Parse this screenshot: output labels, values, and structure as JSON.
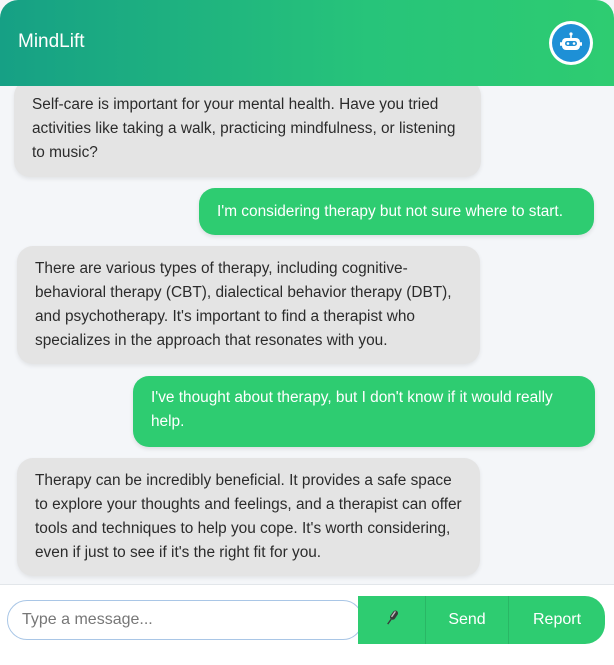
{
  "app": {
    "title": "MindLift"
  },
  "icons": {
    "bot_avatar": "robot-icon",
    "mic": "microphone-icon"
  },
  "colors": {
    "header_start": "#16a085",
    "header_end": "#2ecc71",
    "user_bubble": "#2ecc71",
    "bot_bubble": "#e4e4e4",
    "avatar": "#1e90d6"
  },
  "messages": [
    {
      "sender": "bot",
      "text": "Self-care is important for your mental health. Have you tried activities like taking a walk, practicing mindfulness, or listening to music?"
    },
    {
      "sender": "user",
      "text": "I'm considering therapy but not sure where to start."
    },
    {
      "sender": "bot",
      "text": "There are various types of therapy, including cognitive-behavioral therapy (CBT), dialectical behavior therapy (DBT), and psychotherapy. It's important to find a therapist who specializes in the approach that resonates with you."
    },
    {
      "sender": "user",
      "text": "I've thought about therapy, but I don't know if it would really help."
    },
    {
      "sender": "bot",
      "text": "Therapy can be incredibly beneficial. It provides a safe space to explore your thoughts and feelings, and a therapist can offer tools and techniques to help you cope. It's worth considering, even if just to see if it's the right fit for you."
    }
  ],
  "composer": {
    "placeholder": "Type a message...",
    "value": "",
    "send_label": "Send",
    "report_label": "Report"
  }
}
